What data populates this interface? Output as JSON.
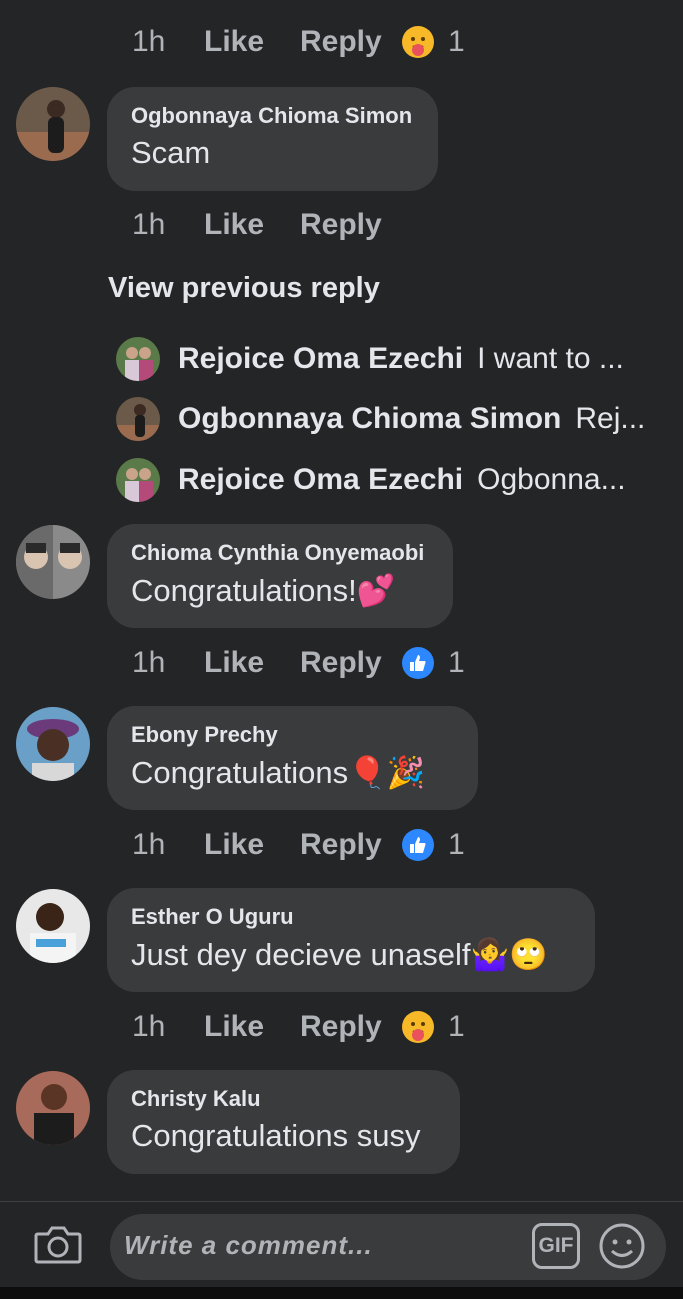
{
  "top_meta": {
    "time": "1h",
    "like": "Like",
    "reply": "Reply",
    "reaction": "1"
  },
  "comments": [
    {
      "author": "Ogbonnaya Chioma Simon",
      "text": "Scam",
      "meta": {
        "time": "1h",
        "like": "Like",
        "reply": "Reply"
      }
    },
    {
      "author": "Chioma Cynthia Onyemaobi",
      "text": "Congratulations!",
      "emoji": "💕",
      "meta": {
        "time": "1h",
        "like": "Like",
        "reply": "Reply",
        "reaction": "1"
      }
    },
    {
      "author": "Ebony Prechy",
      "text": "Congratulations ",
      "emoji": "🎈🎉",
      "meta": {
        "time": "1h",
        "like": "Like",
        "reply": "Reply",
        "reaction": "1"
      }
    },
    {
      "author": "Esther O Uguru",
      "text": "Just dey decieve unaself",
      "emoji": "🤷‍♀️🙄",
      "meta": {
        "time": "1h",
        "like": "Like",
        "reply": "Reply",
        "reaction": "1"
      }
    },
    {
      "author": "Christy Kalu",
      "text": "Congratulations susy"
    }
  ],
  "view_previous": "View previous reply",
  "replies": [
    {
      "name": "Rejoice Oma Ezechi",
      "snippet": "I want to ..."
    },
    {
      "name": "Ogbonnaya Chioma Simon",
      "snippet": "Rej..."
    },
    {
      "name": "Rejoice Oma Ezechi",
      "snippet": "Ogbonna..."
    }
  ],
  "composer": {
    "placeholder": "Write a comment...",
    "gif_label": "GIF"
  },
  "colors": {
    "background": "#242526",
    "bubble": "#3a3b3c",
    "like_blue": "#2d88ff",
    "care_yellow": "#f7b928",
    "muted": "#b0b3b8"
  },
  "icons": {
    "care": "care-reaction-icon",
    "like": "like-reaction-icon",
    "camera": "camera-icon",
    "gif": "gif-icon",
    "sticker": "smiley-icon"
  }
}
